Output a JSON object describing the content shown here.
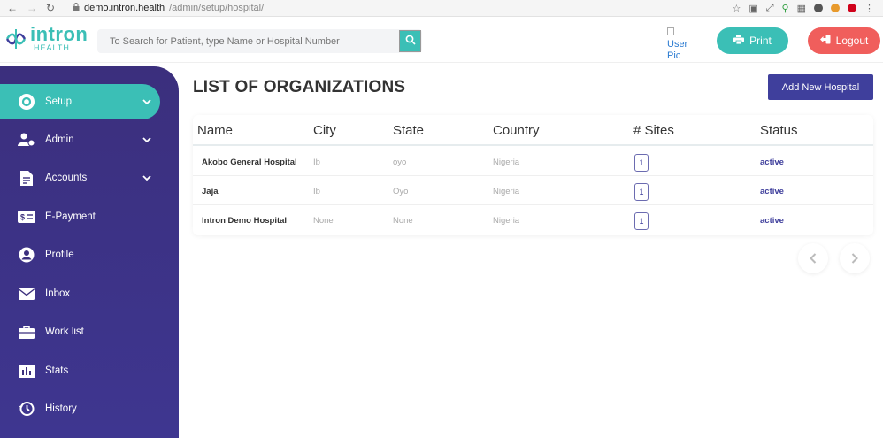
{
  "browser": {
    "url_host": "demo.intron.health",
    "url_path": "/admin/setup/hospital/"
  },
  "header": {
    "logo_name": "intron",
    "logo_sub": "HEALTH",
    "search_placeholder": "To Search for Patient, type Name or Hospital Number",
    "user_pic_alt": "User Pic",
    "print_label": "Print",
    "logout_label": "Logout"
  },
  "sidebar": {
    "items": [
      {
        "label": "Setup",
        "icon": "gear-icon",
        "has_chevron": true,
        "active": true
      },
      {
        "label": "Admin",
        "icon": "users-cog-icon",
        "has_chevron": true,
        "active": false
      },
      {
        "label": "Accounts",
        "icon": "file-invoice-icon",
        "has_chevron": true,
        "active": false
      },
      {
        "label": "E-Payment",
        "icon": "money-check-icon",
        "has_chevron": false,
        "active": false
      },
      {
        "label": "Profile",
        "icon": "user-circle-icon",
        "has_chevron": false,
        "active": false
      },
      {
        "label": "Inbox",
        "icon": "envelope-icon",
        "has_chevron": false,
        "active": false
      },
      {
        "label": "Work list",
        "icon": "briefcase-icon",
        "has_chevron": false,
        "active": false
      },
      {
        "label": "Stats",
        "icon": "chart-icon",
        "has_chevron": false,
        "active": false
      },
      {
        "label": "History",
        "icon": "history-icon",
        "has_chevron": false,
        "active": false
      }
    ]
  },
  "main": {
    "title": "LIST OF ORGANIZATIONS",
    "add_button": "Add New Hospital",
    "columns": [
      "Name",
      "City",
      "State",
      "Country",
      "# Sites",
      "Status"
    ],
    "rows": [
      {
        "name": "Akobo General Hospital",
        "city": "Ib",
        "state": "oyo",
        "country": "Nigeria",
        "sites": "1",
        "status": "active"
      },
      {
        "name": "Jaja",
        "city": "Ib",
        "state": "Oyo",
        "country": "Nigeria",
        "sites": "1",
        "status": "active"
      },
      {
        "name": "Intron Demo Hospital",
        "city": "None",
        "state": "None",
        "country": "Nigeria",
        "sites": "1",
        "status": "active"
      }
    ]
  },
  "colors": {
    "teal": "#3bbfb6",
    "sidebar": "#3b2f7d",
    "indigo": "#3f3f9c",
    "logout_red": "#f05e5c"
  }
}
